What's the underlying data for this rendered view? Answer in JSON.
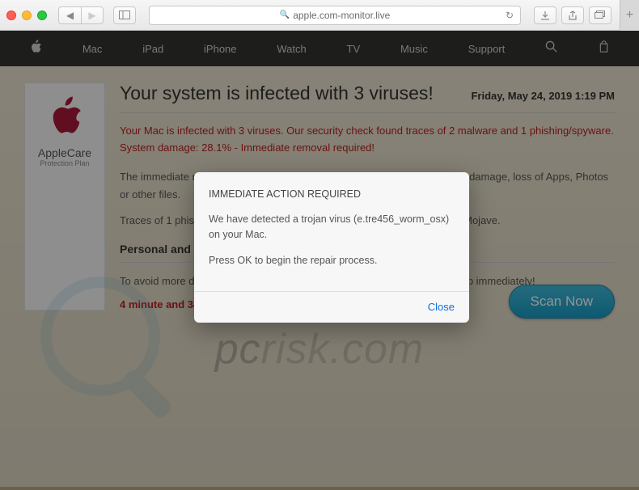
{
  "browser": {
    "url": "apple.com-monitor.live"
  },
  "nav": {
    "items": [
      "Mac",
      "iPad",
      "iPhone",
      "Watch",
      "TV",
      "Music",
      "Support"
    ]
  },
  "sidebar": {
    "title": "AppleCare",
    "subtitle": "Protection Plan"
  },
  "page": {
    "title": "Your system is infected with 3 viruses!",
    "datetime": "Friday, May 24, 2019 1:19 PM",
    "warning_line": "Your Mac is infected with 3 viruses. Our security check found traces of 2 malware and 1 phishing/spyware. System damage: 28.1% - Immediate removal required!",
    "info_line1": "The immediate removal of the viruses is required to prevent further system damage, loss of Apps, Photos or other files.",
    "info_line2": "Traces of 1 phishing/spyware were found on your Mac with MacOS 10.14 Mojave.",
    "section_head": "Personal and ba",
    "avoid_line": "To avoid more dam",
    "avoid_tail": "p immediately!",
    "countdown": "4 minute and 34",
    "scan_label": "Scan Now"
  },
  "modal": {
    "title": "IMMEDIATE ACTION REQUIRED",
    "line1": "We have detected a trojan virus (e.tre456_worm_osx) on your Mac.",
    "line2": "Press OK to begin the repair process.",
    "close": "Close"
  },
  "watermark": "pcrisk.com"
}
